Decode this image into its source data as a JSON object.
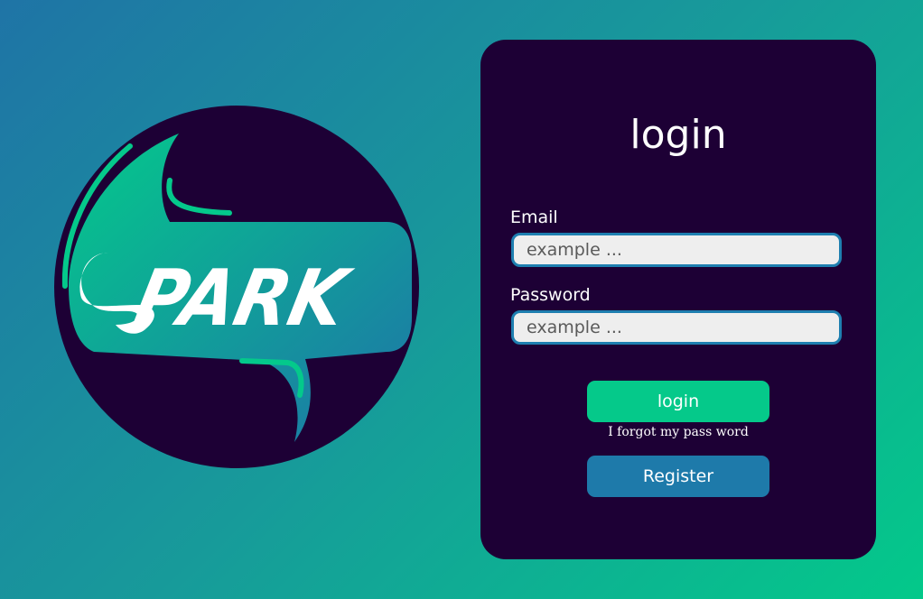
{
  "logo": {
    "brand": "SPARK",
    "icon": "spark-speech-bubble-logo"
  },
  "login_form": {
    "title": "login",
    "email": {
      "label": "Email",
      "placeholder": "example ..."
    },
    "password": {
      "label": "Password",
      "placeholder": "example ..."
    },
    "login_button": "login",
    "forgot_link": "I forgot my pass word",
    "register_button": "Register"
  },
  "colors": {
    "background_start": "#1f74a6",
    "background_end": "#03c98a",
    "panel": "#1d0035",
    "accent_green": "#05c98a",
    "accent_blue": "#1e7aaa"
  }
}
